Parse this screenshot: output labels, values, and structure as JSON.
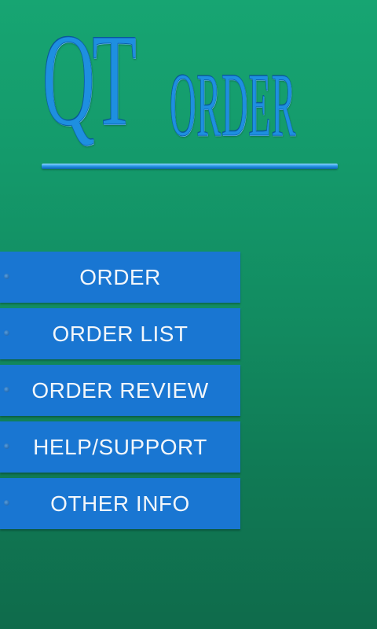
{
  "logo": {
    "qt": "QT",
    "order": "ORDER"
  },
  "menu": {
    "items": [
      {
        "label": "ORDER"
      },
      {
        "label": "ORDER LIST"
      },
      {
        "label": "ORDER REVIEW"
      },
      {
        "label": "HELP/SUPPORT"
      },
      {
        "label": "OTHER INFO"
      }
    ]
  },
  "colors": {
    "background_top": "#17a572",
    "background_bottom": "#0f6b4b",
    "button": "#1976d2",
    "logo": "#1e8fe0",
    "button_text": "#f2f6fa"
  }
}
